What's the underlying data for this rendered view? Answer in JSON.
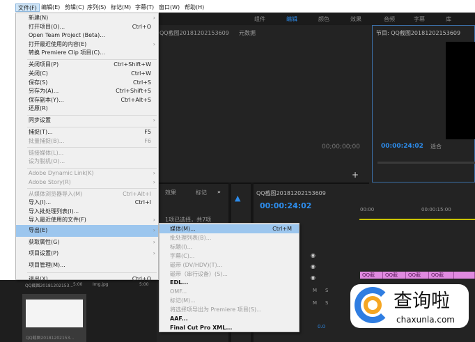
{
  "menubar": [
    "文件(F)",
    "编辑(E)",
    "剪辑(C)",
    "序列(S)",
    "标记(M)",
    "字幕(T)",
    "窗口(W)",
    "帮助(H)"
  ],
  "workspaces": [
    "组件",
    "编辑",
    "颜色",
    "效果",
    "音频",
    "字幕",
    "库"
  ],
  "source_panel": {
    "title": "QQ截图20181202153609",
    "tab2": "元数据",
    "timecode": "00;00;00;00"
  },
  "program_panel": {
    "title": "节目: QQ截图20181202153609",
    "timecode": "00:00:24:02",
    "fit": "适合"
  },
  "project_panel": {
    "tabs": [
      "效果",
      "标记"
    ],
    "status": "1项已选择，共7项",
    "items": [
      {
        "name": "QQ截图20181202153...",
        "dur": "5:00"
      },
      {
        "name": "Img.jpg",
        "dur": "5:00"
      }
    ]
  },
  "timeline": {
    "title": "QQ截图20181202153609",
    "timecode": "00:00:24:02",
    "ruler": [
      "00:00",
      "00:00:15:00"
    ],
    "clip_label": "QQ截",
    "volume": "0.0",
    "track_buttons": [
      "M",
      "S"
    ]
  },
  "file_menu": [
    {
      "label": "新建(N)",
      "sub": true
    },
    {
      "label": "打开项目(O)...",
      "shortcut": "Ctrl+O"
    },
    {
      "label": "Open Team Project (Beta)..."
    },
    {
      "label": "打开最近使用的内容(E)",
      "sub": true
    },
    {
      "label": "转换 Premiere Clip 项目(C)..."
    },
    {
      "sep": true
    },
    {
      "label": "关闭项目(P)",
      "shortcut": "Ctrl+Shift+W"
    },
    {
      "label": "关闭(C)",
      "shortcut": "Ctrl+W"
    },
    {
      "label": "保存(S)",
      "shortcut": "Ctrl+S"
    },
    {
      "label": "另存为(A)...",
      "shortcut": "Ctrl+Shift+S"
    },
    {
      "label": "保存副本(Y)...",
      "shortcut": "Ctrl+Alt+S"
    },
    {
      "label": "还原(R)"
    },
    {
      "sep": true
    },
    {
      "label": "同步设置",
      "sub": true
    },
    {
      "sep": true
    },
    {
      "label": "捕捉(T)...",
      "shortcut": "F5"
    },
    {
      "label": "批量捕捉(B)...",
      "shortcut": "F6",
      "disabled": true
    },
    {
      "sep": true
    },
    {
      "label": "链接媒体(L)...",
      "disabled": true
    },
    {
      "label": "设为脱机(O)...",
      "disabled": true
    },
    {
      "sep": true
    },
    {
      "label": "Adobe Dynamic Link(K)",
      "sub": true,
      "disabled": true
    },
    {
      "label": "Adobe Story(R)",
      "sub": true,
      "disabled": true
    },
    {
      "sep": true
    },
    {
      "label": "从媒体浏览器导入(M)",
      "shortcut": "Ctrl+Alt+I",
      "disabled": true
    },
    {
      "label": "导入(I)...",
      "shortcut": "Ctrl+I"
    },
    {
      "label": "导入批处理列表(I)..."
    },
    {
      "label": "导入最近使用的文件(F)",
      "sub": true
    },
    {
      "label": "导出(E)",
      "sub": true,
      "highlighted": true
    },
    {
      "label": "获取属性(G)",
      "sub": true
    },
    {
      "label": "项目设置(P)",
      "sub": true
    },
    {
      "label": "项目管理(M)..."
    },
    {
      "sep": true
    },
    {
      "label": "退出(X)",
      "shortcut": "Ctrl+Q"
    }
  ],
  "export_menu": [
    {
      "label": "媒体(M)...",
      "shortcut": "Ctrl+M",
      "highlighted": true
    },
    {
      "label": "批处理列表(B)...",
      "disabled": true
    },
    {
      "label": "标题(I)...",
      "disabled": true
    },
    {
      "label": "字幕(C)...",
      "disabled": true
    },
    {
      "label": "磁带 (DV/HDV)(T)...",
      "disabled": true
    },
    {
      "label": "磁带（串行设备）(S)...",
      "disabled": true
    },
    {
      "label": "EDL..."
    },
    {
      "label": "OMF...",
      "disabled": true
    },
    {
      "label": "标记(M)...",
      "disabled": true
    },
    {
      "label": "将选择项导出为 Premiere 项目(S)...",
      "disabled": true
    },
    {
      "label": "AAF..."
    },
    {
      "label": "Final Cut Pro XML..."
    }
  ],
  "watermark": {
    "text": "查询啦",
    "url": "chaxunla.com"
  },
  "colors": {
    "accent": "#2d8ceb",
    "highlight": "#9cc6ee",
    "clip": "#e08ae0"
  }
}
